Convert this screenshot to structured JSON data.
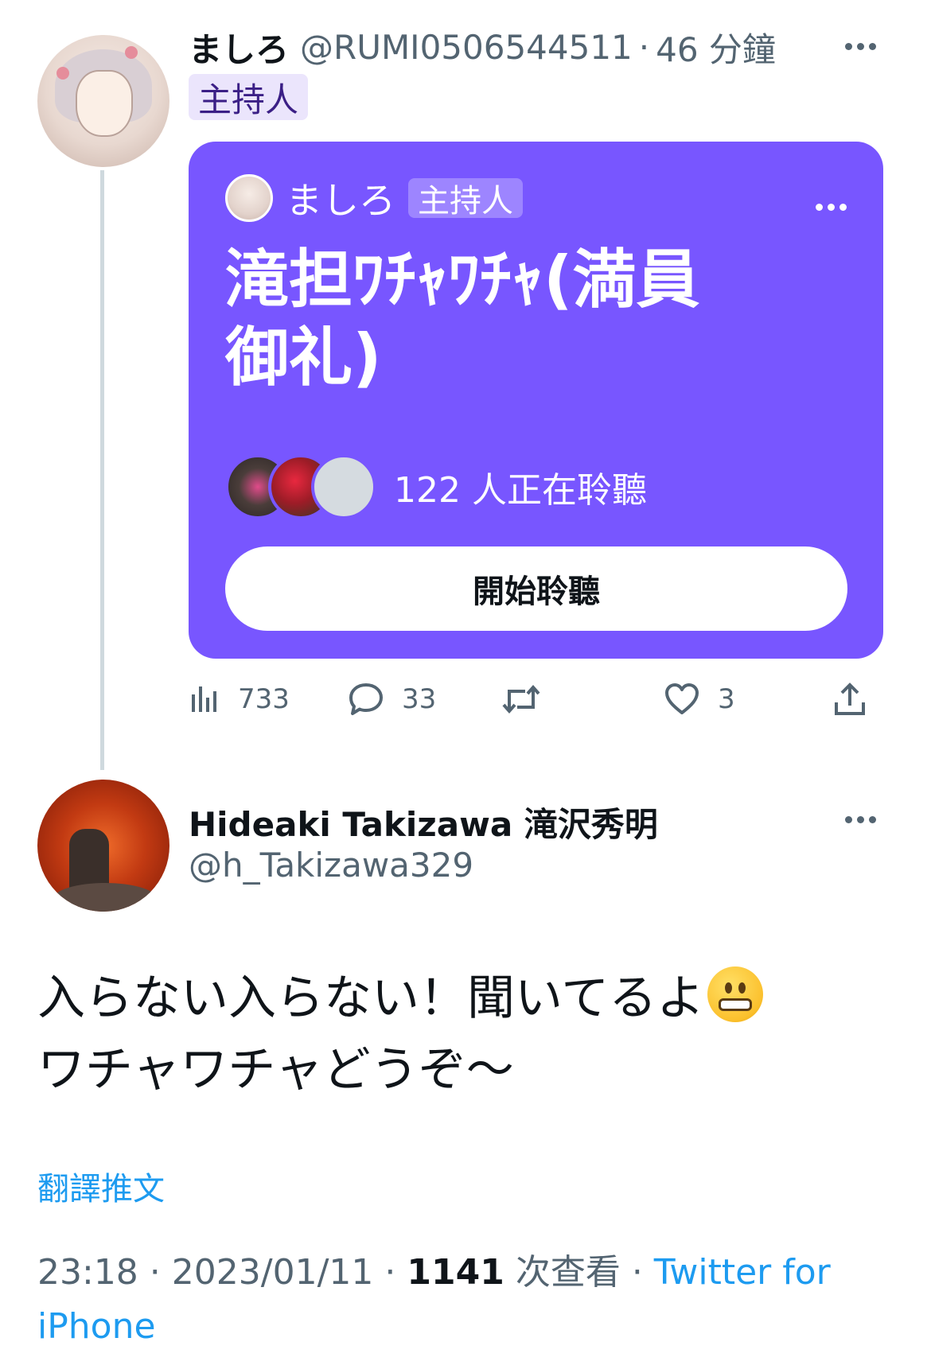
{
  "tweet1": {
    "name": "ましろ",
    "handle": "@RUMI0506544511",
    "separator": "·",
    "time": "46 分鐘",
    "host_badge": "主持人",
    "space": {
      "host_name": "ましろ",
      "host_badge": "主持人",
      "title": "滝担ﾜﾁｬﾜﾁｬ(満員御礼)",
      "listeners_text": "122 人正在聆聽",
      "button_label": "開始聆聽"
    },
    "actions": {
      "views": "733",
      "replies": "33",
      "retweets": "",
      "likes": "3"
    }
  },
  "tweet2": {
    "name": "Hideaki Takizawa 滝沢秀明",
    "handle": "@h_Takizawa329",
    "text_line1": "入らない入らない！聞いてるよ",
    "text_line2": "ワチャワチャどうぞ〜",
    "translate": "翻譯推文",
    "meta": {
      "time": "23:18",
      "sep1": " · ",
      "date": "2023/01/11",
      "sep2": " · ",
      "views_count": "1141",
      "views_label": " 次查看",
      "sep3": " · ",
      "source": "Twitter for iPhone"
    }
  },
  "icons": [
    "more-icon",
    "views-icon",
    "reply-icon",
    "retweet-icon",
    "like-icon",
    "share-icon",
    "grimacing-emoji"
  ],
  "colors": {
    "space_card": "#7856ff",
    "link": "#1d9bf0",
    "secondary_text": "#536471",
    "host_badge_bg": "#ebe5fc"
  }
}
